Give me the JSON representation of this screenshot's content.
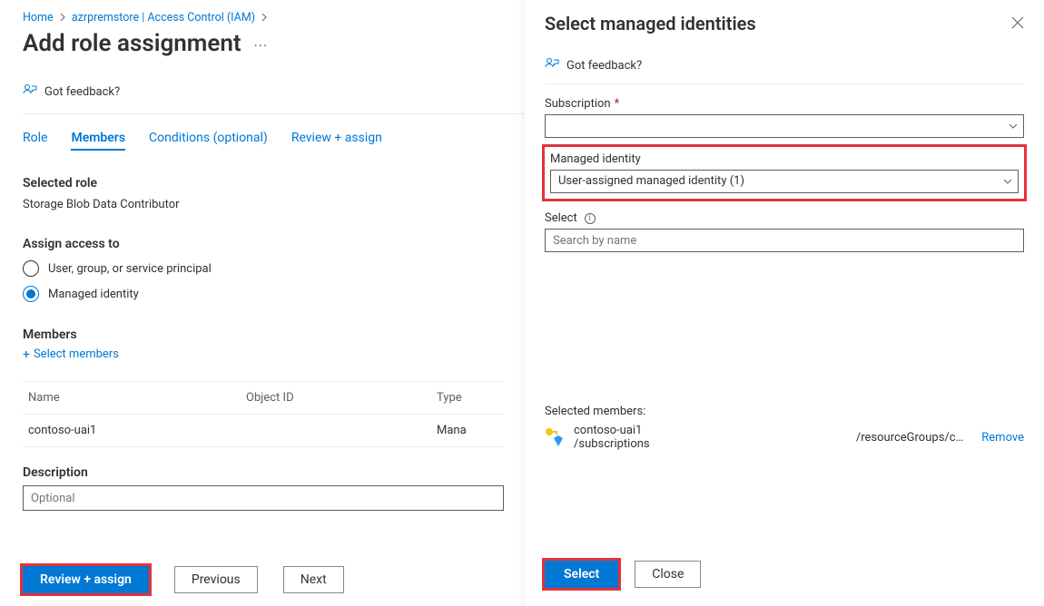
{
  "breadcrumb": {
    "home": "Home",
    "resource": "azrpremstore | Access Control (IAM)"
  },
  "page_title": "Add role assignment",
  "feedback_label": "Got feedback?",
  "tabs": {
    "role": "Role",
    "members": "Members",
    "conditions": "Conditions (optional)",
    "review": "Review + assign"
  },
  "selected_role": {
    "label": "Selected role",
    "value": "Storage Blob Data Contributor"
  },
  "assign_access": {
    "label": "Assign access to",
    "option_user": "User, group, or service principal",
    "option_mi": "Managed identity"
  },
  "members": {
    "label": "Members",
    "select_link": "Select members",
    "col_name": "Name",
    "col_obj": "Object ID",
    "col_type": "Type",
    "row_name": "contoso-uai1",
    "row_type": "Mana"
  },
  "description": {
    "label": "Description",
    "placeholder": "Optional"
  },
  "footer": {
    "review": "Review + assign",
    "previous": "Previous",
    "next": "Next"
  },
  "panel": {
    "title": "Select managed identities",
    "feedback": "Got feedback?",
    "subscription_label": "Subscription",
    "mi_label": "Managed identity",
    "mi_value": "User-assigned managed identity (1)",
    "select_label": "Select",
    "search_placeholder": "Search by name",
    "selected_label": "Selected members:",
    "selected_name": "contoso-uai1",
    "selected_subs": "/subscriptions",
    "selected_rg": "/resourceGroups/c…",
    "remove": "Remove",
    "btn_select": "Select",
    "btn_close": "Close"
  }
}
